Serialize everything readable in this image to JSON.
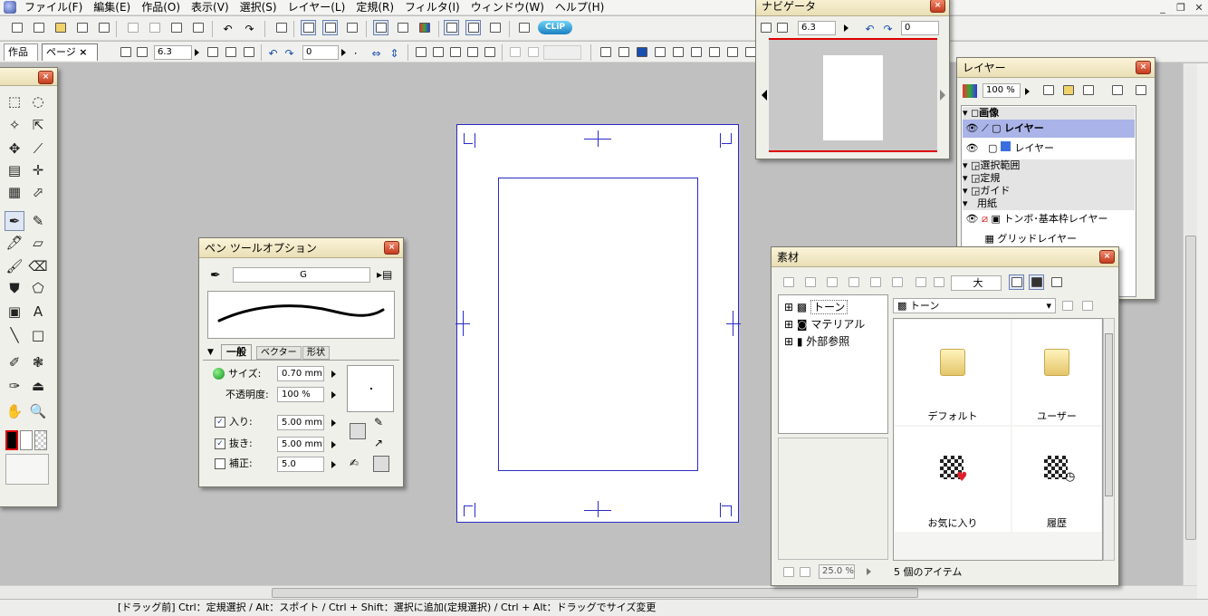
{
  "menubar": {
    "items": [
      "ファイル(F)",
      "編集(E)",
      "作品(O)",
      "表示(V)",
      "選択(S)",
      "レイヤー(L)",
      "定規(R)",
      "フィルタ(I)",
      "ウィンドウ(W)",
      "ヘルプ(H)"
    ]
  },
  "toolbar": {
    "clip_label": "CLiP",
    "rotate_value": "6.3",
    "angle_value": "0"
  },
  "tabs": {
    "work": "作品",
    "page": "ページ",
    "page_close": "×"
  },
  "tools_palette": {
    "close": "×"
  },
  "pen_options": {
    "title": "ペン ツールオプション",
    "brush_name": "G",
    "tabs": [
      "一般",
      "ベクター",
      "形状"
    ],
    "size_label": "サイズ:",
    "size_value": "0.70 mm",
    "opacity_label": "不透明度:",
    "opacity_value": "100 %",
    "in_label": "入り:",
    "in_value": "5.00 mm",
    "out_label": "抜き:",
    "out_value": "5.00 mm",
    "correction_label": "補正:",
    "correction_value": "5.0",
    "in_checked": "✓",
    "out_checked": "✓",
    "close": "×"
  },
  "navigator": {
    "title": "ナビゲータ",
    "zoom_value": "6.3",
    "angle_value": "0",
    "close": "×"
  },
  "layer_palette": {
    "title": "レイヤー",
    "opacity": "100 %",
    "rows": {
      "image_group": "画像",
      "layer1": "レイヤー",
      "layer2": "レイヤー",
      "selection": "選択範囲",
      "ruler": "定規",
      "guide": "ガイド",
      "paper": "用紙",
      "crop_layer": "トンボ･基本枠レイヤー",
      "grid_layer": "グリッドレイヤー"
    },
    "close": "×"
  },
  "materials": {
    "title": "素材",
    "size_select": "大",
    "tree": [
      "トーン",
      "マテリアル",
      "外部参照"
    ],
    "folder_select": "トーン",
    "items": [
      "デフォルト",
      "ユーザー",
      "お気に入り",
      "履歴"
    ],
    "zoom": "25.0 %",
    "item_count": "5 個のアイテム",
    "close": "×"
  },
  "statusbar": {
    "text": "[ドラッグ前] Ctrl：定規選択 / Alt：スポイト / Ctrl + Shift：選択に追加(定規選択) / Ctrl + Alt：ドラッグでサイズ変更"
  },
  "colors": {
    "paper_border": "#2a2ac8",
    "palette_title": "#f4ecc6",
    "close_button": "#d9533a",
    "selected_layer": "#aab4e8"
  }
}
